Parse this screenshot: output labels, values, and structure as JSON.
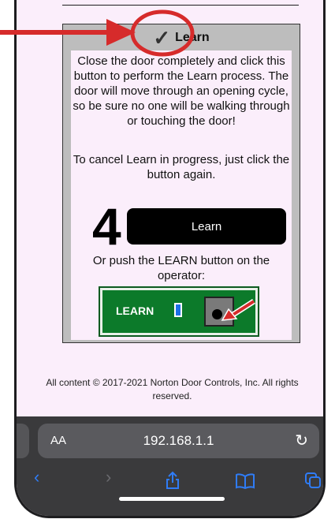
{
  "panel": {
    "title": "Learn",
    "check_icon": "✓",
    "instruction": "Close the door completely and click this button to perform the Learn process. The door will move through an opening cycle, so be sure no one will be walking through or touching the door!",
    "cancel_note": "To cancel Learn in progress, just click the button again.",
    "step_number": "4",
    "learn_button": "Learn",
    "alt_instruction": "Or push the LEARN button on the operator:",
    "operator_label": "LEARN"
  },
  "footer": {
    "copyright": "All content © 2017-2021 Norton Door Controls, Inc. All rights reserved."
  },
  "browser": {
    "text_size_label": "AA",
    "url": "192.168.1.1"
  },
  "colors": {
    "page_bg": "#fbeefb",
    "panel_bg": "#bdbdbd",
    "operator_green": "#0c7a2a",
    "annotation_red": "#d62b2b",
    "safari_blue": "#2f7cf6"
  }
}
